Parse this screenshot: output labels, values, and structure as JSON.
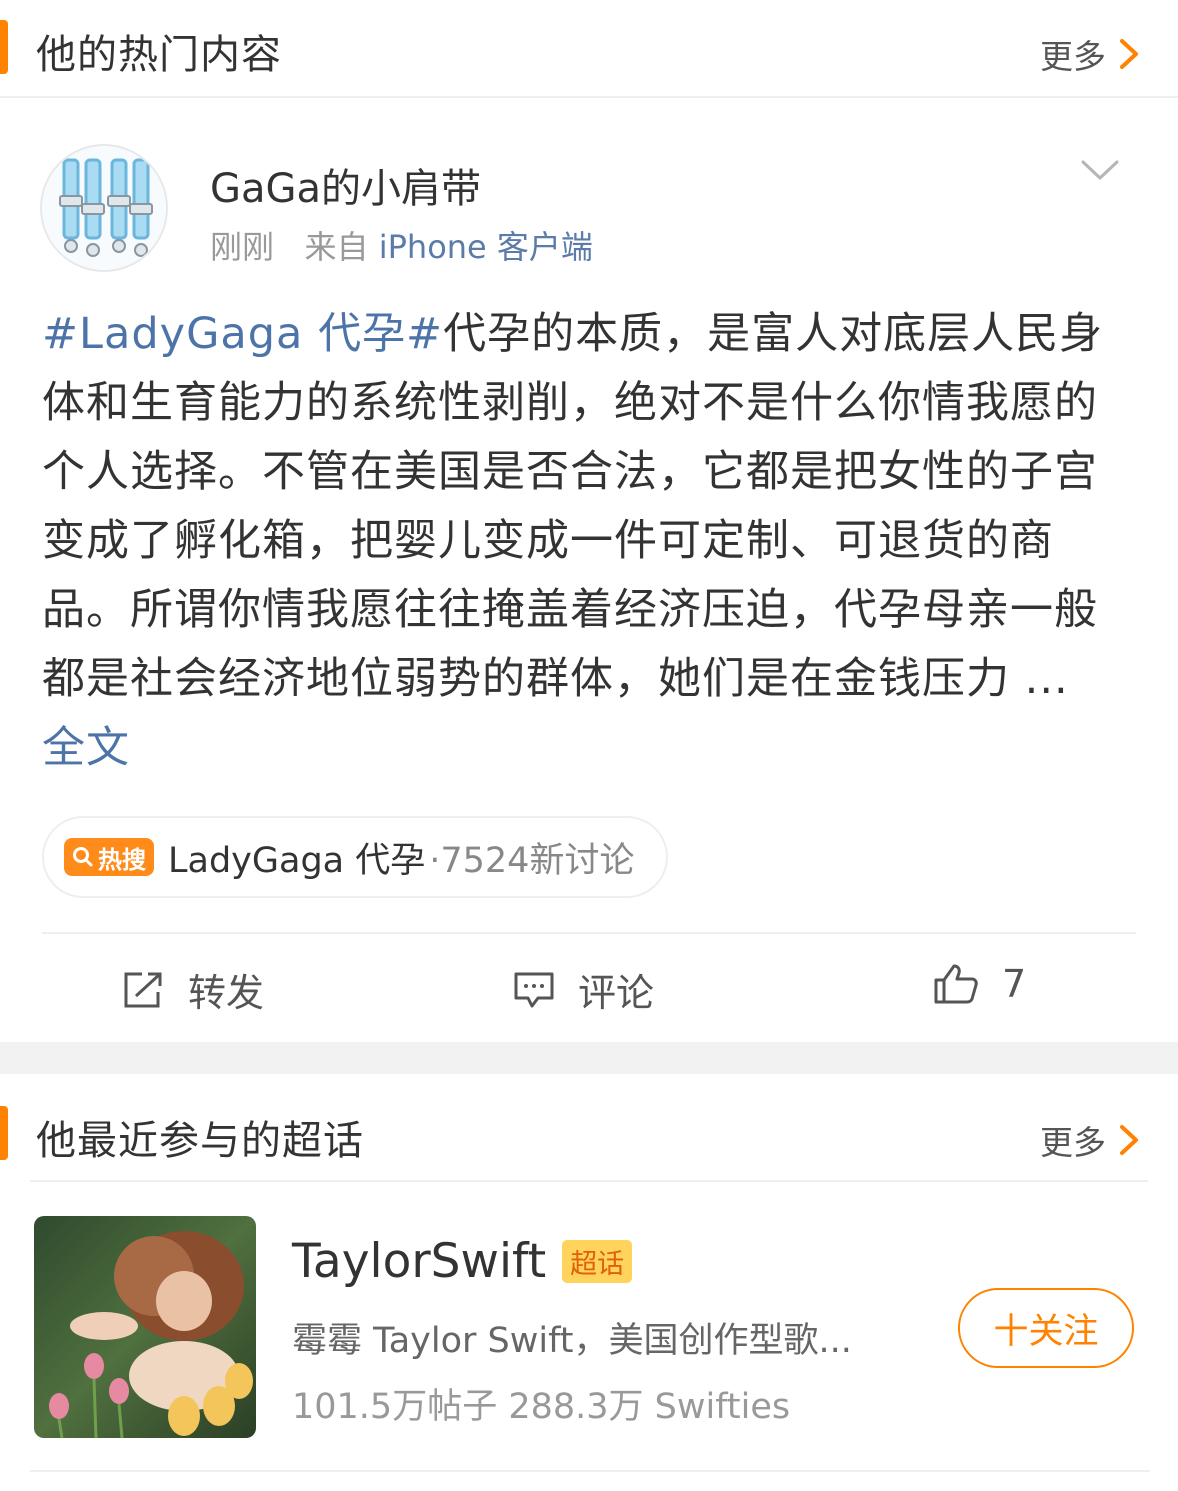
{
  "hot_section": {
    "title": "他的热门内容",
    "more_label": "更多"
  },
  "post": {
    "username": "GaGa的小肩带",
    "time": "刚刚",
    "source_prefix": "来自",
    "source_app": "iPhone 客户端",
    "hashtag": "#LadyGaga 代孕#",
    "body": "代孕的本质，是富人对底层人民身体和生育能力的系统性剥削，绝对不是什么你情我愿的个人选择。不管在美国是否合法，它都是把女性的子宫变成了孵化箱，把婴儿变成一件可定制、可退货的商品。所谓你情我愿往往掩盖着经济压迫，代孕母亲一般都是社会经济地位弱势的群体，她们是在金钱压力 ... ",
    "full_text_label": "全文",
    "hot_search": {
      "badge": "热搜",
      "name": "LadyGaga 代孕",
      "count": "·7524新讨论"
    },
    "actions": {
      "repost_label": "转发",
      "comment_label": "评论",
      "like_count": "7"
    }
  },
  "topics_section": {
    "title": "他最近参与的超话",
    "more_label": "更多"
  },
  "topic": {
    "name": "TaylorSwift",
    "badge": "超话",
    "description": "霉霉 Taylor Swift，美国创作型歌...",
    "stats": "101.5万帖子 288.3万 Swifties",
    "follow_label": "十关注"
  },
  "colors": {
    "accent": "#ff8200",
    "link": "#4d74a8",
    "badge_bg": "#ffd35c"
  },
  "icons": [
    "chevron-right-icon",
    "chevron-down-icon",
    "search-icon",
    "share-icon",
    "comment-icon",
    "thumbs-up-icon"
  ]
}
